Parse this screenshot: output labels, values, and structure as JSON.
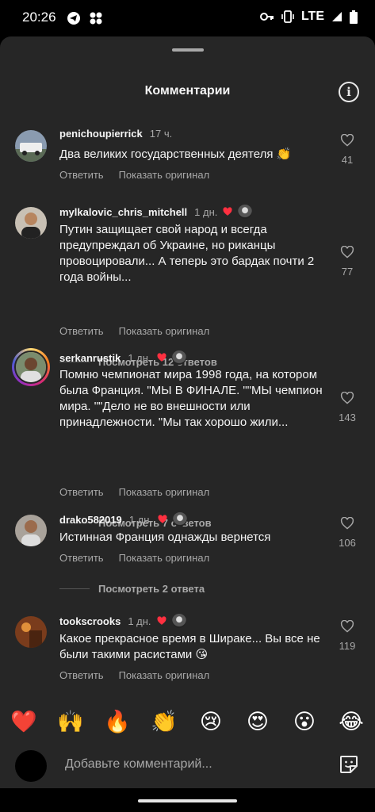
{
  "status_bar": {
    "time": "20:26",
    "network": "LTE"
  },
  "sheet": {
    "title": "Комментарии"
  },
  "comments": [
    {
      "username": "penichoupierrick",
      "time": "17 ч.",
      "text": "Два великих государственных деятеля 👏",
      "reply": "Ответить",
      "translate": "Показать оригинал",
      "likes": "41"
    },
    {
      "username": "mylkalovic_chris_mitchell",
      "time": "1 дн.",
      "text": "Путин защищает свой народ и всегда предупреждал об Украине, но риканцы провоцировали... А теперь это бардак почти 2 года войны...",
      "reply": "Ответить",
      "translate": "Показать оригинал",
      "likes": "77",
      "view_replies": "Посмотреть 12 ответов"
    },
    {
      "username": "serkanrustik",
      "time": "1 дн.",
      "text": "Помню чемпионат мира 1998 года, на котором была Франция. \"МЫ В ФИНАЛЕ. \"\"МЫ чемпион мира. \"\"Дело не во внешности или принадлежности. \"Мы так хорошо жили...",
      "reply": "Ответить",
      "translate": "Показать оригинал",
      "likes": "143",
      "view_replies": "Посмотреть 7 ответов"
    },
    {
      "username": "drako582019",
      "time": "1 дн.",
      "text": "Истинная Франция однажды вернется",
      "reply": "Ответить",
      "translate": "Показать оригинал",
      "likes": "106",
      "view_replies": "Посмотреть 2 ответа"
    },
    {
      "username": "tookscrooks",
      "time": "1 дн.",
      "text": "Какое прекрасное время в Шираке... Вы все не были такими расистами 😘",
      "reply": "Ответить",
      "translate": "Показать оригинал",
      "likes": "119"
    }
  ],
  "reactions": [
    "❤️",
    "🙌",
    "🔥",
    "👏",
    "😢",
    "😍",
    "😮",
    "😂"
  ],
  "composer": {
    "placeholder": "Добавьте комментарий..."
  },
  "colors": {
    "sheet_bg": "#262626",
    "secondary_text": "#a8a8a8",
    "heart_red": "#ff3040"
  }
}
